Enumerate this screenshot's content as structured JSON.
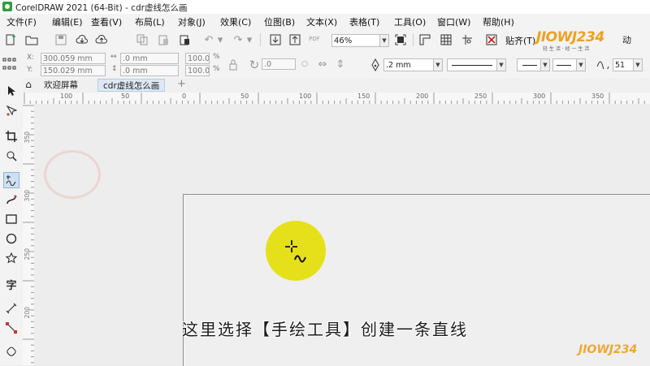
{
  "window": {
    "title": "CorelDRAW 2021 (64-Bit) - cdr虚线怎么画"
  },
  "menu": [
    "文件(F)",
    "编辑(E)",
    "查看(V)",
    "布局(L)",
    "对象(J)",
    "效果(C)",
    "位图(B)",
    "文本(X)",
    "表格(T)",
    "工具(O)",
    "窗口(W)",
    "帮助(H)"
  ],
  "toolbar": {
    "zoom_value": "46%",
    "snap_label": "贴齐(T)",
    "pdf_label": "PDF"
  },
  "property_bar": {
    "x_value": "300.059 mm",
    "y_value": "150.029 mm",
    "width_value": ".0 mm",
    "height_value": ".0 mm",
    "scale_x": "100.0",
    "scale_y": "100.0",
    "percent": "%",
    "angle_value": ".0",
    "outline_width": ".2 mm",
    "smoothing_value": "51"
  },
  "tabs": [
    {
      "label": "欢迎屏幕"
    },
    {
      "label": "cdr虚线怎么画"
    }
  ],
  "ruler": {
    "h_labels": [
      "100",
      "50",
      "0",
      "50",
      "100",
      "150",
      "200",
      "250",
      "300",
      "350"
    ],
    "v_labels": [
      "350",
      "300",
      "250",
      "200"
    ]
  },
  "caption": "这里选择【手绘工具】创建一条直线",
  "watermark": {
    "brand": "JIOWJ234",
    "brand_sub": "轻 生 活 · 经 一 生 活",
    "bottom": "JIOWJ234"
  },
  "colors": {
    "highlight": "#e6e01a",
    "app_green": "#2f9e3f",
    "watermark_orange": "#f0a020"
  }
}
